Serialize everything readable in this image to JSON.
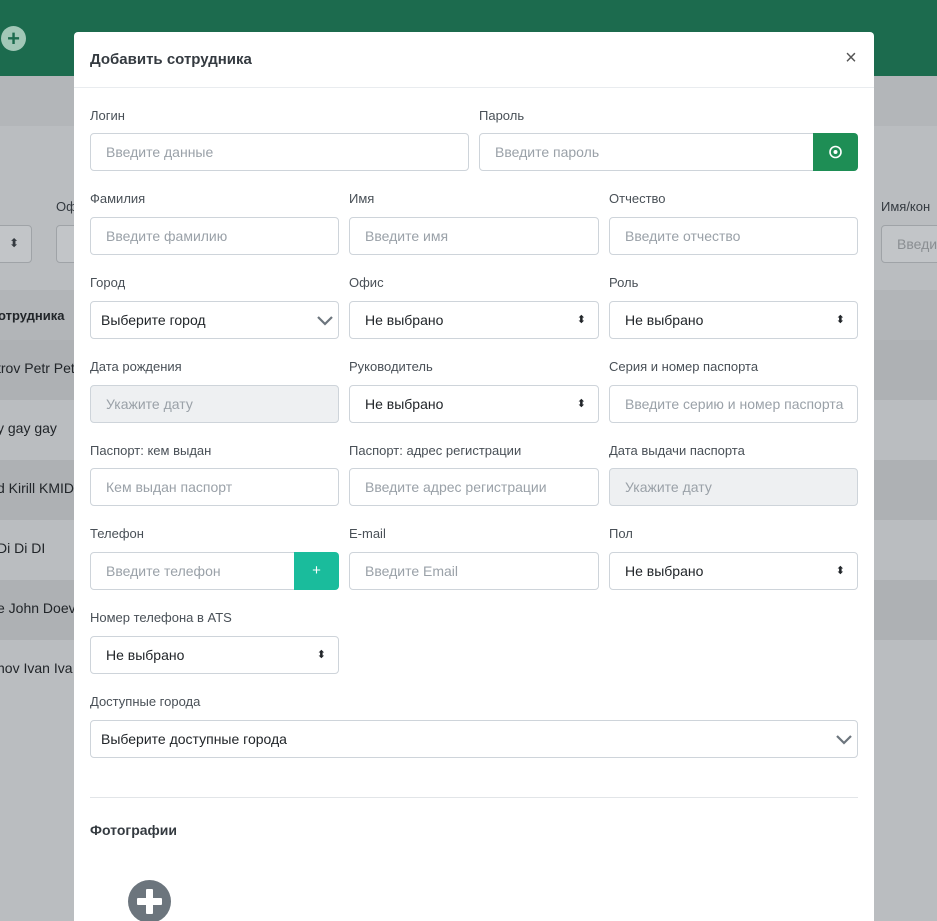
{
  "background": {
    "table_header": "отрудника",
    "filter_label_office": "Оф",
    "filter_label_name": "Имя/кон",
    "filter_input_placeholder": "Введи",
    "rows": [
      {
        "name": "trov Petr Pet"
      },
      {
        "name": "y gay gay"
      },
      {
        "name": "d Kirill KMID"
      },
      {
        "name": "Di Di DI"
      },
      {
        "name": "e John Doev"
      },
      {
        "name": "nov Ivan Iva"
      }
    ]
  },
  "modal": {
    "title": "Добавить сотрудника",
    "close_label": "×",
    "fields": {
      "login": {
        "label": "Логин",
        "placeholder": "Введите данные"
      },
      "password": {
        "label": "Пароль",
        "placeholder": "Введите пароль"
      },
      "last_name": {
        "label": "Фамилия",
        "placeholder": "Введите фамилию"
      },
      "first_name": {
        "label": "Имя",
        "placeholder": "Введите имя"
      },
      "patronymic": {
        "label": "Отчество",
        "placeholder": "Введите отчество"
      },
      "city": {
        "label": "Город",
        "value": "Выберите город"
      },
      "office": {
        "label": "Офис",
        "value": "Не выбрано"
      },
      "role": {
        "label": "Роль",
        "value": "Не выбрано"
      },
      "birth_date": {
        "label": "Дата рождения",
        "placeholder": "Укажите дату"
      },
      "manager": {
        "label": "Руководитель",
        "value": "Не выбрано"
      },
      "passport_number": {
        "label": "Серия и номер паспорта",
        "placeholder": "Введите серию и номер паспорта"
      },
      "passport_issued_by": {
        "label": "Паспорт: кем выдан",
        "placeholder": "Кем выдан паспорт"
      },
      "passport_address": {
        "label": "Паспорт: адрес регистрации",
        "placeholder": "Введите адрес регистрации"
      },
      "passport_issue_date": {
        "label": "Дата выдачи паспорта",
        "placeholder": "Укажите дату"
      },
      "phone": {
        "label": "Телефон",
        "placeholder": "Введите телефон",
        "add_label": "+"
      },
      "email": {
        "label": "E-mail",
        "placeholder": "Введите Email"
      },
      "gender": {
        "label": "Пол",
        "value": "Не выбрано"
      },
      "ats_phone": {
        "label": "Номер телефона в ATS",
        "value": "Не выбрано"
      },
      "available_cities": {
        "label": "Доступные города",
        "value": "Выберите доступные города"
      }
    },
    "photos_title": "Фотографии",
    "sort_glyph": "◆"
  },
  "colors": {
    "topbar": "#1c6b4e",
    "password_button": "#1e8e55",
    "phone_add_button": "#1abc9c"
  }
}
